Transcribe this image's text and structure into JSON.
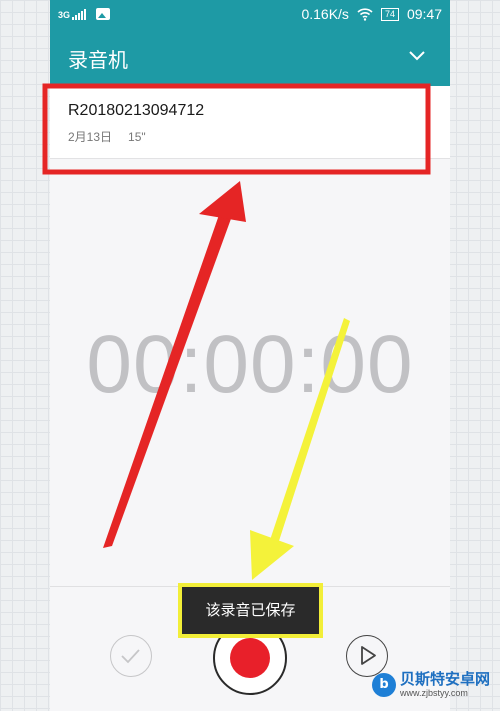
{
  "status_bar": {
    "network": "3G",
    "speed": "0.16K/s",
    "battery": "74",
    "time": "09:47",
    "icons": [
      "signal-icon",
      "image-icon",
      "wifi-icon",
      "battery-icon"
    ]
  },
  "app_bar": {
    "title": "录音机",
    "menu_icon": "chevron-down-icon"
  },
  "recording": {
    "name": "R20180213094712",
    "date": "2月13日",
    "duration": "15\""
  },
  "timer": "00:00:00",
  "controls": {
    "confirm_icon": "check-icon",
    "record_icon": "record-icon",
    "play_icon": "play-icon"
  },
  "toast": "该录音已保存",
  "annotations": {
    "highlight_color": "#e52525",
    "arrow_red_color": "#e52525",
    "arrow_yellow_color": "#f4f23a"
  },
  "watermark": {
    "title": "贝斯特安卓网",
    "url": "www.zjbstyy.com"
  },
  "colors": {
    "accent": "#1e9aa5",
    "record": "#e8202a"
  }
}
